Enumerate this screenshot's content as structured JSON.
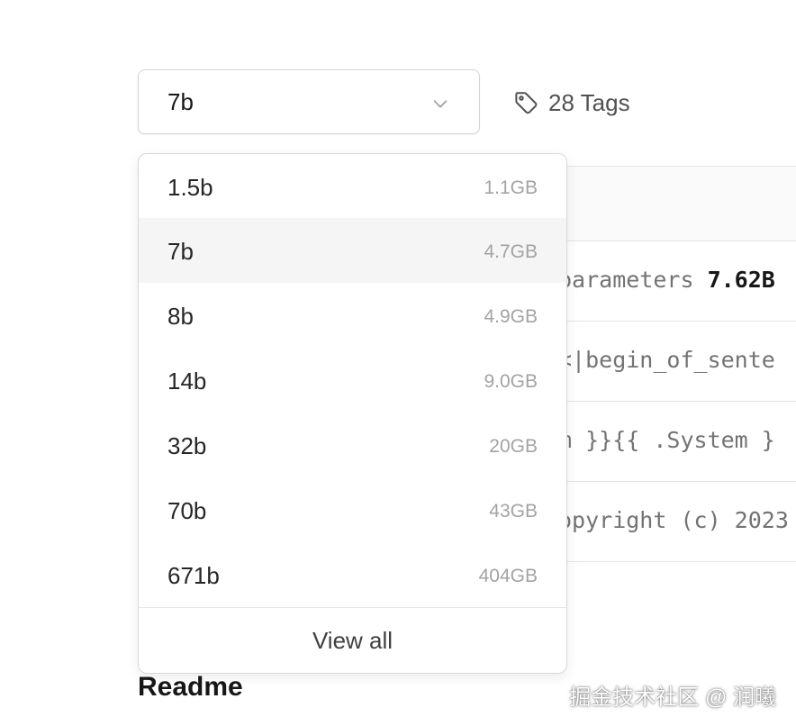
{
  "version_select": {
    "value": "7b"
  },
  "tags": {
    "label": "28 Tags",
    "icon": "tag-icon"
  },
  "model_table": {
    "rows": [
      {
        "prefix": "parameters ",
        "value": "7.62B"
      },
      {
        "prefix": "<|begin_of_sente",
        "value": ""
      },
      {
        "prefix": "m }}{{ .System }",
        "value": ""
      },
      {
        "prefix": "opyright (c) 2023",
        "value": ""
      }
    ]
  },
  "dropdown": {
    "options": [
      {
        "label": "1.5b",
        "size": "1.1GB",
        "selected": false
      },
      {
        "label": "7b",
        "size": "4.7GB",
        "selected": true
      },
      {
        "label": "8b",
        "size": "4.9GB",
        "selected": false
      },
      {
        "label": "14b",
        "size": "9.0GB",
        "selected": false
      },
      {
        "label": "32b",
        "size": "20GB",
        "selected": false
      },
      {
        "label": "70b",
        "size": "43GB",
        "selected": false
      },
      {
        "label": "671b",
        "size": "404GB",
        "selected": false
      }
    ],
    "view_all_label": "View all"
  },
  "readme": {
    "heading": "Readme"
  },
  "watermark": {
    "text": "掘金技术社区 @ 润曦"
  },
  "colors": {
    "selected_bg": "#f5f5f5",
    "border": "#d4d4d4",
    "muted_text": "#a3a3a3"
  }
}
